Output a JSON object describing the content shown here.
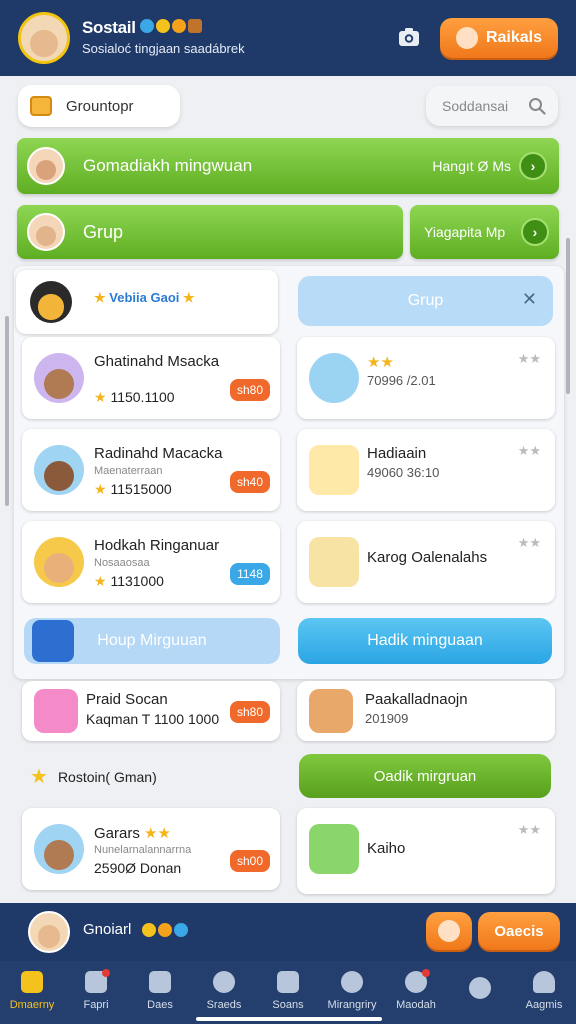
{
  "header": {
    "title": "Sostail",
    "subtitle": "Sosialoć tingjaan saadábrek",
    "action_label": "Raikals"
  },
  "search_row": {
    "group_chip": "Grountopr",
    "search_placeholder": "Soddansai"
  },
  "green_bars": [
    {
      "label": "Gomadiakh mingwuan",
      "right_label": "Hangıt Ø Ms"
    },
    {
      "label": "Grup"
    },
    {
      "label": "Yiagapita Mp"
    }
  ],
  "panel": {
    "profile_label": "Vebiia Gaoi",
    "grup_label": "Grup",
    "left_cards": [
      {
        "name": "Ghatinahd Msacka",
        "sub": "",
        "score": "1150.1100",
        "button": "sh80",
        "button_color": "#f0682a"
      },
      {
        "name": "Radinahd Macacka",
        "sub": "Maenaterraan",
        "score": "11515000",
        "button": "sh40",
        "button_color": "#f0682a"
      },
      {
        "name": "Hodkah  Ringanuar",
        "sub": "Nosaaosaa",
        "score": "1131000",
        "button": "1148",
        "button_color": "#3aa8e6"
      }
    ],
    "right_cards": [
      {
        "title": "",
        "sub": "70996 /2.01",
        "icon_color": "#9ad4f2"
      },
      {
        "title": "Hadiaain",
        "sub": "49060 36:10",
        "icon_color": "#ffe9a8"
      },
      {
        "title": "Karog Oalenalahs",
        "sub": "",
        "icon_color": "#ffffff"
      }
    ],
    "left_button": "Houp Mirguuan",
    "right_button": "Hadik minguaan"
  },
  "lower": {
    "item_left": {
      "name": "Praid Socan",
      "score": "Kaqman T 1100 1000",
      "button": "sh80"
    },
    "item_right": {
      "title": "Paakalladnaojn",
      "sub": "201909"
    },
    "section_label": "Rostoin( Gman)",
    "green_button": "Oadik mirgruan",
    "item_left2": {
      "name": "Garars",
      "sub": "Nunelarnalannarrna",
      "score": "2590Ø Donan",
      "button": "sh00"
    },
    "item_right2": {
      "title": "Kaiho"
    }
  },
  "bottom_bar": {
    "name": "Gnoiarl",
    "action_label": "Oaecis"
  },
  "nav": [
    {
      "label": "Dmaerny",
      "active": true,
      "badge": false
    },
    {
      "label": "Fapri",
      "active": false,
      "badge": true
    },
    {
      "label": "Daes",
      "active": false,
      "badge": false
    },
    {
      "label": "Sraeds",
      "active": false,
      "badge": false
    },
    {
      "label": "Soans",
      "active": false,
      "badge": false
    },
    {
      "label": "Mirangriry",
      "active": false,
      "badge": false
    },
    {
      "label": "Maodah",
      "active": false,
      "badge": true
    },
    {
      "label": "",
      "active": false,
      "badge": false
    },
    {
      "label": "Aagmis",
      "active": false,
      "badge": false
    }
  ],
  "icons": {
    "camera": "camera-icon",
    "search": "search-icon",
    "bag": "bag-icon",
    "go": "chevron-right-icon",
    "close": "close-icon",
    "star": "star-icon"
  },
  "colors": {
    "header_bg": "#1f3a68",
    "accent_green": "#6bbb2c",
    "accent_orange": "#f5862a",
    "accent_blue": "#2aa5e4"
  }
}
